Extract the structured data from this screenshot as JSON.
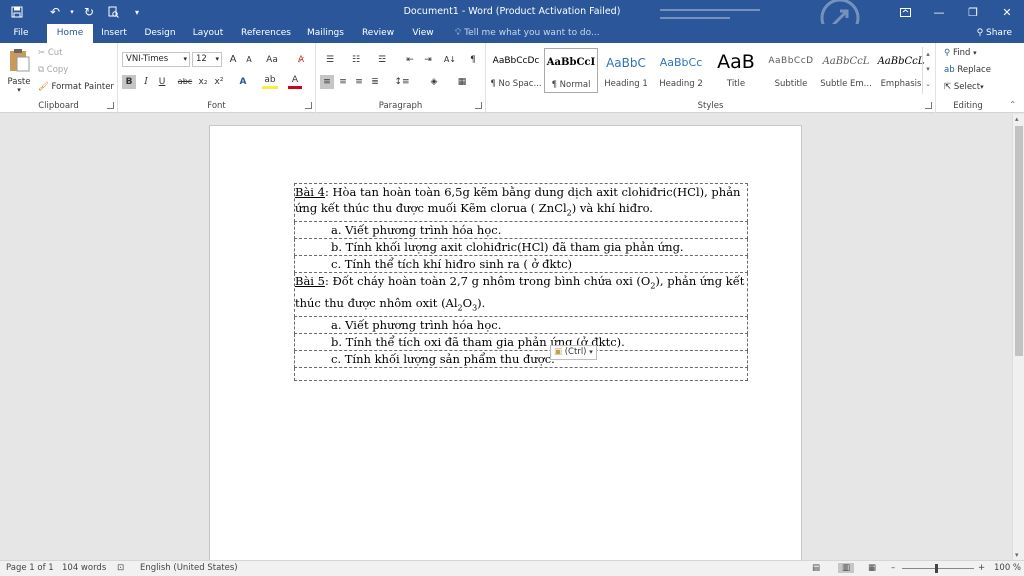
{
  "titlebar": {
    "title": "Document1 - Word (Product Activation Failed)",
    "qat": [
      "save-icon",
      "undo-icon",
      "redo-icon",
      "print-preview-icon",
      "customize-icon"
    ]
  },
  "tabs": [
    {
      "label": "File"
    },
    {
      "label": "Home"
    },
    {
      "label": "Insert"
    },
    {
      "label": "Design"
    },
    {
      "label": "Layout"
    },
    {
      "label": "References"
    },
    {
      "label": "Mailings"
    },
    {
      "label": "Review"
    },
    {
      "label": "View"
    }
  ],
  "tellme": "Tell me what you want to do...",
  "share": "Share",
  "clipboard": {
    "paste": "Paste",
    "cut": "Cut",
    "copy": "Copy",
    "format_painter": "Format Painter",
    "label": "Clipboard"
  },
  "font": {
    "family": "VNI-Times",
    "size": "12",
    "grow": "A",
    "shrink": "A",
    "case": "Aa",
    "bold": "B",
    "italic": "I",
    "underline": "U",
    "strike": "abc",
    "sub": "x₂",
    "sup": "x²",
    "effects": "A",
    "highlight": "ab",
    "color": "A",
    "label": "Font"
  },
  "paragraph": {
    "label": "Paragraph",
    "pilcrow": "¶"
  },
  "styles": {
    "label": "Styles",
    "items": [
      {
        "sample": "AaBbCcDc",
        "name": "¶ No Spac..."
      },
      {
        "sample": "AaBbCcI",
        "name": "¶ Normal"
      },
      {
        "sample": "AaBbC",
        "name": "Heading 1"
      },
      {
        "sample": "AaBbCc",
        "name": "Heading 2"
      },
      {
        "sample": "AaB",
        "name": "Title"
      },
      {
        "sample": "AaBbCcD",
        "name": "Subtitle"
      },
      {
        "sample": "AaBbCcL",
        "name": "Subtle Em..."
      },
      {
        "sample": "AaBbCcL",
        "name": "Emphasis"
      }
    ]
  },
  "editing": {
    "find": "Find",
    "replace": "Replace",
    "select": "Select",
    "label": "Editing"
  },
  "doc": {
    "b4_label": "Bài 4",
    "b4_line1": ":  Hòa tan hoàn toàn 6,5g kẽm bằng  dung dịch axit clohiđric(HCl), phản",
    "b4_line2a": "ứng kết thúc thu được muối Kẽm clorua ( ZnCl",
    "b4_line2_sub": "2",
    "b4_line2b": ") và khí hiđro.",
    "b4_a": "a. Viết phương trình hóa học.",
    "b4_b": "b. Tính khối lượng axit clohiđric(HCl) đã tham gia phản ứng.",
    "b4_c": "c. Tính thể tích khí hiđro sinh ra ( ở đktc)",
    "b5_label": "Bài 5",
    "b5_line1a": ": Đốt cháy hoàn toàn 2,7 g nhôm trong bình chứa oxi (O",
    "b5_line1_sub": "2",
    "b5_line1b": "), phản ứng kết",
    "b5_line2a": "thúc thu được nhôm oxit (Al",
    "b5_line2_sub1": "2",
    "b5_line2b": "O",
    "b5_line2_sub2": "3",
    "b5_line2c": ").",
    "b5_a": "a. Viết phương trình hóa học.",
    "b5_b": "b. Tính thể tích oxi đã tham gia phản ứng (ở đktc).",
    "b5_c": "c. Tính khối lượng sản phẩm thu được.",
    "paste_tag": "(Ctrl)"
  },
  "status": {
    "page": "Page 1 of 1",
    "words": "104 words",
    "language": "English (United States)",
    "zoom": "100 %",
    "zoom_level": 100
  }
}
